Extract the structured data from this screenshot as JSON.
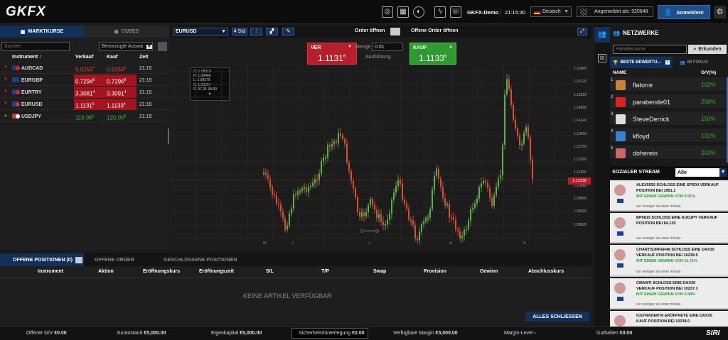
{
  "topbar": {
    "logo": "GKFX",
    "account": "GKFX-Demo",
    "clock": "21:15:30",
    "language": "Deutsch",
    "logged_in_as": "Angemeldet als: 920848",
    "login_label": "Anmelden!"
  },
  "quotes": {
    "tab_active": "MARKTKURSE",
    "tab_inactive": "CUBES",
    "search_placeholder": "Suchen",
    "filter": "Bevorzugte Auswa",
    "headers": {
      "instrument": "Instrument",
      "sell": "Verkauf",
      "buy": "Kauf",
      "time": "Zeit"
    },
    "rows": [
      {
        "symbol": "AUDCAD",
        "sell_main": "0.9253",
        "sell_pip": "7",
        "buy_main": "0.9263",
        "buy_pip": "3",
        "time": "21:15",
        "direction": "down",
        "highlight": false,
        "sell_color": "#e8413a",
        "buy_color": "#e8413a"
      },
      {
        "symbol": "EURGBP",
        "sell_main": "0.7294",
        "sell_pip": "5",
        "buy_main": "0.7296",
        "buy_pip": "8",
        "time": "21:15",
        "direction": "down",
        "highlight": true,
        "sell_color": "#ffffff",
        "buy_color": "#ffffff"
      },
      {
        "symbol": "EURTRY",
        "sell_main": "3.3081",
        "sell_pip": "4",
        "buy_main": "3.3091",
        "buy_pip": "4",
        "time": "21:15",
        "direction": "down",
        "highlight": true,
        "sell_color": "#ffffff",
        "buy_color": "#ffffff"
      },
      {
        "symbol": "EURUSD",
        "sell_main": "1.1131",
        "sell_pip": "6",
        "buy_main": "1.1133",
        "buy_pip": "4",
        "time": "21:15",
        "direction": "down",
        "highlight": true,
        "sell_color": "#ffffff",
        "buy_color": "#ffffff"
      },
      {
        "symbol": "USDJPY",
        "sell_main": "119.98",
        "sell_pip": "5",
        "buy_main": "120.00",
        "buy_pip": "8",
        "time": "21:15",
        "direction": "up",
        "highlight": false,
        "sell_color": "#3bb03b",
        "buy_color": "#3bb03b"
      }
    ]
  },
  "chart": {
    "symbol": "EURUSD",
    "period": "4 Std",
    "order_open": "Order öffnen",
    "pending_open": "Offene Order öffnen",
    "sell_label": "VER",
    "sell_main": "1.1131",
    "sell_pip": "6",
    "buy_label": "KAUF",
    "buy_main": "1.1133",
    "buy_pip": "6",
    "amount_label": "Menge",
    "amount_value": "0.01",
    "execution_label": "Ausführung",
    "ohlc": {
      "o": "O: 1.08319",
      "h": "H: 1.09468",
      "l": "L: 1.09275",
      "c": "C: 1.09367",
      "d": "D: 07-31 00:00"
    },
    "price_badge": "1.11318",
    "price_ticks": [
      "1.16800",
      "1.16120",
      "1.15530",
      "1.14830",
      "1.14140",
      "1.13400",
      "1.12700",
      "1.12000",
      "1.11360",
      "1.10660",
      "1.09900",
      "1.09220",
      "1.08500"
    ],
    "time_ticks": [
      "M",
      "J",
      "J",
      "A",
      "S"
    ]
  },
  "positions": {
    "tabs": [
      "OFFENE POSITIONEN (0)",
      "OFFENE ORDER",
      "GESCHLOSSENE POSITIONEN"
    ],
    "columns": [
      "Instrument",
      "Aktion",
      "Eröffnungskurs",
      "Eröffnungszeit",
      "S/L",
      "T/P",
      "Swap",
      "Provision",
      "Gewinn",
      "Abschlusskurs"
    ],
    "empty_text": "KEINE ARTIKEL VERFÜGBAR",
    "close_all": "ALLES SCHLIESSEN"
  },
  "status": {
    "items": [
      {
        "label": "Offener G/V",
        "value": "€0.00"
      },
      {
        "label": "Kontostand",
        "value": "€5,000.00"
      },
      {
        "label": "Eigenkapital",
        "value": "€5,000.00"
      },
      {
        "label": "Sicherheitshinterlegung",
        "value": "€0.00"
      },
      {
        "label": "Verfügbare Margin",
        "value": "€5,000.00"
      },
      {
        "label": "Margin-Level",
        "value": "-"
      },
      {
        "label": "Guthaben",
        "value": "€0.00"
      }
    ],
    "brand": "SIRI"
  },
  "network": {
    "title": "NETZWERKE",
    "search_placeholder": "Händlername",
    "search_button": "Erkunden",
    "tab_best": "BESTE BEWERTU...",
    "tab_focus": "IM FOKUS",
    "col_name": "NAME",
    "col_pct": "G/V(%)",
    "traders": [
      {
        "rank": "1",
        "name": "flatorre",
        "pct": "102%"
      },
      {
        "rank": "2",
        "name": "parabende01",
        "pct": "258%"
      },
      {
        "rank": "3",
        "name": "SteveDerrick",
        "pct": "150%"
      },
      {
        "rank": "4",
        "name": "kfloyd",
        "pct": "131%"
      },
      {
        "rank": "5",
        "name": "doherein",
        "pct": "203%"
      }
    ],
    "stream_title": "SOZIALER STREAM",
    "stream_filter": "Alle",
    "stream": [
      {
        "l1": "ALEX5555 SCHLOSS EINE SPS00 VERKAUF",
        "l2": "POSITION BEI 1951.1",
        "l3": "MIT EINEM GEWINN VON 0.91%",
        "time": "vor weniger als einer minute"
      },
      {
        "l1": "BP0815 SCHLOSS EINE AUDJPY VERKAUF",
        "l2": "POSITION BEI 84.139",
        "l3": "",
        "time": "vor weniger als einer minute"
      },
      {
        "l1": "CHARTSURFER48 SCHLOSS EINE DAX30",
        "l2": "VERKAUF POSITION BEI 10238.5",
        "l3": "MIT EINEM GEWINN VON 11.71%",
        "time": "vor weniger als einer minute"
      },
      {
        "l1": "CMANTI SCHLOSS EINE DAX30",
        "l2": "VERKAUF POSITION BEI 10237.3",
        "l3": "MIT EINEM GEWINN VON 0.98%",
        "time": "vor weniger als einer minute"
      },
      {
        "l1": "ICETRADER78 ERÖFFNETE EINE DAX30",
        "l2": "KAUF POSITION BEI 10238.0",
        "l3": "",
        "time": ""
      }
    ]
  }
}
